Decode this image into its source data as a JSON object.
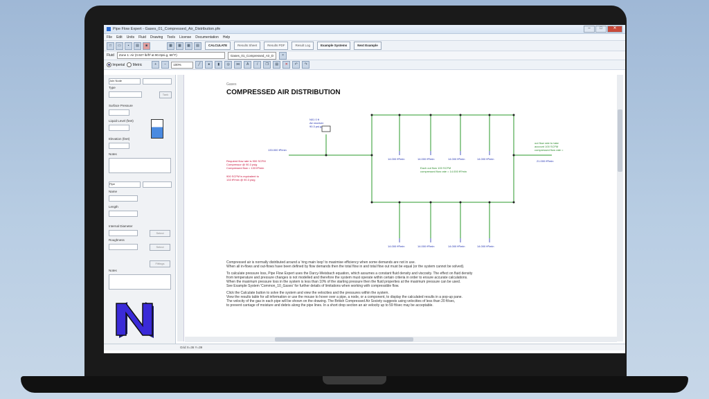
{
  "app": {
    "window_title": "Pipe Flow Expert - Gases_01_Compressed_Air_Distribution.pfe",
    "menu": [
      "File",
      "Edit",
      "Units",
      "Fluid",
      "Drawing",
      "Tools",
      "License",
      "Documentation",
      "Help"
    ],
    "toolbar_buttons": {
      "calculate": "CALCULATE",
      "results_sheet": "Results Sheet",
      "results_pdf": "Results PDF",
      "result_log": "Result Log",
      "example_systems": "Example Systems",
      "next_example": "Next Example"
    },
    "fluid_label": "Fluid",
    "fluid_value": "Zone 1: Air (0.927 lb/ft³ at 90.0psi.g, 68°F)",
    "doc_tab": "Gases_01_Compressed_Air_D",
    "units": {
      "imperial": "Imperial",
      "metric": "Metric",
      "selected": "imperial"
    },
    "zoom": "100%",
    "status": "Grid  X=36  Y=39"
  },
  "left_panel": {
    "node_type_label": "Type",
    "node_select": "Join Node",
    "surface_pressure": "Surface Pressure",
    "liquid_level": "Liquid Level (feet)",
    "elevation": "Elevation (feet)",
    "notes": "Notes",
    "pipe_select": "Pipe",
    "pipe_name": "Name",
    "length": "Length",
    "internal_diameter": "Internal Diameter",
    "roughness": "Roughness",
    "notes2": "Notes",
    "btn_tank": "Tank",
    "btn_select": "Select",
    "btn_roughness": "Select",
    "btn_fittings": "Fittings"
  },
  "drawing": {
    "small_header": "Gases",
    "title": "COMPRESSED AIR DISTRIBUTION",
    "left_note": [
      "Required flow rate is 900 SCFM",
      "Compressor @ 90.3 psig",
      "Compressed flow = 133 ft³/min"
    ],
    "left_note2": [
      "900 SCFM is equivalent to",
      "133 ft³/min @ 90.3 psig"
    ],
    "right_note": [
      "Each out flow 100 SCFM",
      "compressed flow rate = 14.000 ft³/min"
    ],
    "far_right_note": [
      "out flow rate to take",
      "account 100 SCFM",
      "compressed flow rate ="
    ],
    "inflow_label": "133.000 ft³/min",
    "outflow_label": "21.000 ft³/min",
    "receiver_label": [
      "N01 0 ft",
      "Air receiver",
      "90.3 psi.g"
    ],
    "outlet_flow": "14.000 ft³/min"
  },
  "description": [
    "Compressed air is normally distributed around a 'ring main loop' to maximise efficiency when some demands are not in use.",
    "When all in-flows and out-flows have been defined by flow demands then the total flow in and total flow out must be equal (or the system cannot be solved).",
    "",
    "To calculate pressure loss, Pipe Flow Expert uses the Darcy-Weisbach equation, which assumes a constant fluid density and viscosity. The effect on fluid density",
    "from temperature and pressure changes is not modelled and therefore the system must operate within certain criteria in order to ensure accurate calculations.",
    "When the maximum pressure loss in the system is less than 10% of the starting pressure then the fluid properties at the maximum pressure can be used.",
    "See Example System 'Common_10_Gases' for further details of limitations when working with compressible flow.",
    "",
    "Click the Calculate button to solve the system and view the velocities and the pressures within the system.",
    "View the results table for all information or use the mouse to hover over a pipe, a node, or a component, to display the calculated results in a pop-up pane.",
    "The velocity of the gas in each pipe will be shown on the drawing. The British Compressed Air Society suggests using velocities of less than 20 ft/sec,",
    "to prevent carriage of moisture and debris along the pipe lines. In a short drop section an air velocity up to 59 ft/sec may be acceptable."
  ],
  "colors": {
    "pipe": "#2a9a2a",
    "label": "#2030b0",
    "note_red": "#c8103a",
    "note_green": "#2a8a2a",
    "logo": "#3a2ad8"
  }
}
